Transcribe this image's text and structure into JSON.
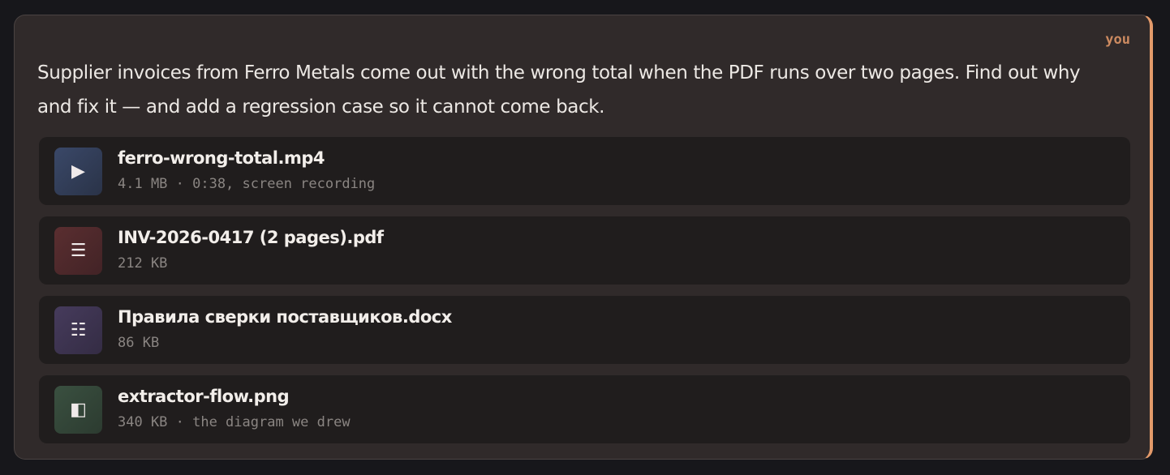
{
  "message": {
    "author": "you",
    "text": "Supplier invoices from Ferro Metals come out with the wrong total when the PDF runs over two pages. Find out why and fix it — and add a regression case so it cannot come back."
  },
  "attachments": [
    {
      "name": "ferro-wrong-total.mp4",
      "meta": "4.1 MB · 0:38, screen recording",
      "icon": "play-icon",
      "glyph": "▶"
    },
    {
      "name": "INV-2026-0417 (2 pages).pdf",
      "meta": "212 KB",
      "icon": "document-lines-icon",
      "glyph": "☰"
    },
    {
      "name": "Правила сверки поставщиков.docx",
      "meta": "86 KB",
      "icon": "text-document-icon",
      "glyph": "☷"
    },
    {
      "name": "extractor-flow.png",
      "meta": "340 KB · the diagram we drew",
      "icon": "image-icon",
      "glyph": "◧"
    }
  ],
  "colors": {
    "accent": "#e39a6a",
    "author": "#cc8a60",
    "background": "#17171b",
    "bubble": "#302a2a",
    "card": "#201d1d"
  }
}
